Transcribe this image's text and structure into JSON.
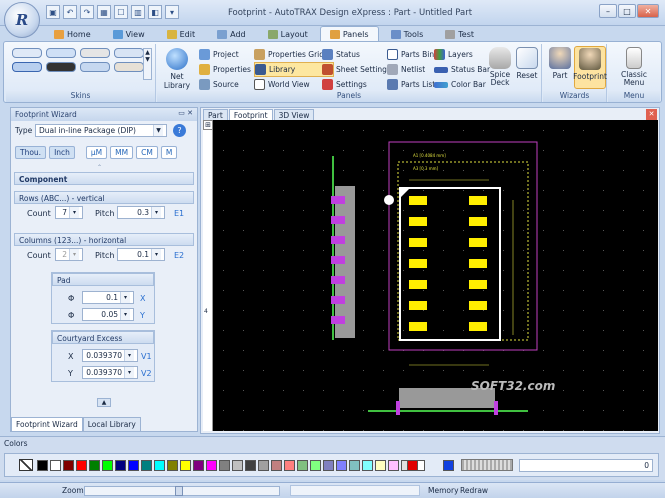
{
  "app": {
    "title": "Footprint - AutoTRAX Design eXpress : Part - Untitled Part",
    "logo_text": "R"
  },
  "tabs": [
    {
      "label": "Home",
      "color": "#e8a040"
    },
    {
      "label": "View",
      "color": "#5a9ad8"
    },
    {
      "label": "Edit",
      "color": "#d8b440"
    },
    {
      "label": "Add",
      "color": "#7aa0d0"
    },
    {
      "label": "Layout",
      "color": "#8aa86a"
    },
    {
      "label": "Panels",
      "color": "#e0a040"
    },
    {
      "label": "Tools",
      "color": "#6a8ec8"
    },
    {
      "label": "Test",
      "color": "#a0a0a0"
    }
  ],
  "active_tab": "Panels",
  "ribbon": {
    "skins_label": "Skins",
    "net_library": "Net Library",
    "panels_label": "Panels",
    "col1": [
      "Project",
      "Properties",
      "Source"
    ],
    "col2": [
      "Properties Grid.",
      "Library",
      "World View"
    ],
    "col3": [
      "Status",
      "Sheet Settings",
      "Settings"
    ],
    "col4": [
      "Parts Bin",
      "Netlist",
      "Parts List"
    ],
    "col5": [
      "Layers",
      "Status Bar",
      "Color Bar"
    ],
    "spice_deck": "Spice Deck",
    "reset": "Reset",
    "wizards_label": "Wizards",
    "part": "Part",
    "footprint": "Footprint",
    "classic_menu": "Classic Menu",
    "menu_label": "Menu"
  },
  "wizard": {
    "title": "Footprint Wizard",
    "type_label": "Type",
    "type_value": "Dual in-line Package (DIP)",
    "units": [
      "Thou.",
      "Inch",
      "µM",
      "MM",
      "CM",
      "M"
    ],
    "component_label": "Component",
    "rows_header": "Rows (ABC...) - vertical",
    "rows_count_label": "Count",
    "rows_count": "7",
    "rows_pitch_label": "Pitch",
    "rows_pitch": "0.3",
    "rows_tag": "E1",
    "cols_header": "Columns (123...) - horizontal",
    "cols_count_label": "Count",
    "cols_count": "2",
    "cols_pitch_label": "Pitch",
    "cols_pitch": "0.1",
    "cols_tag": "E2",
    "pad_header": "Pad",
    "pad_phi1_label": "Φ",
    "pad_phi1": "0.1",
    "pad_x": "X",
    "pad_phi2_label": "Φ",
    "pad_phi2": "0.05",
    "pad_y": "Y",
    "court_header": "Courtyard Excess",
    "court_x_label": "X",
    "court_x": "0.039370",
    "court_x_tag": "V1",
    "court_y_label": "Y",
    "court_y": "0.039370",
    "court_y_tag": "V2",
    "bottom_tabs": [
      "Footprint Wizard",
      "Local Library"
    ]
  },
  "document": {
    "tabs": [
      "Part",
      "Footprint",
      "3D View"
    ],
    "ruler_marks": [
      "5",
      "8"
    ],
    "ruler_v": "4",
    "watermark": "SOFT32.com",
    "dim_top": "A1 [0.4084 mm]",
    "dim_top2": "A3 [0.3 mm]"
  },
  "colors_panel": {
    "label": "Colors",
    "swatches": [
      "#000000",
      "#ffffff",
      "#800000",
      "#ff0000",
      "#008000",
      "#00ff00",
      "#000080",
      "#0000ff",
      "#008080",
      "#00ffff",
      "#808000",
      "#ffff00",
      "#800080",
      "#ff00ff",
      "#808080",
      "#c0c0c0",
      "#404040",
      "#a0a0a0",
      "#c08080",
      "#ff8080",
      "#80c080",
      "#80ff80",
      "#8080c0",
      "#8080ff",
      "#80c0c0",
      "#80ffff",
      "#ffffc0",
      "#ffc0ff",
      "#e0e0e0",
      "#ffffff"
    ],
    "selected_red": "#e00000",
    "selected_blue": "#1040e0",
    "value": "0"
  },
  "status": {
    "zoom": "Zoom",
    "memory": "Memory",
    "redraw": "Redraw"
  }
}
